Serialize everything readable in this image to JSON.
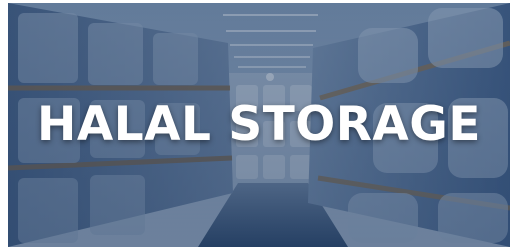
{
  "banner": {
    "title": "HALAL STORAGE",
    "overlay_color": "#1f3a60",
    "text_color": "#ffffff"
  }
}
